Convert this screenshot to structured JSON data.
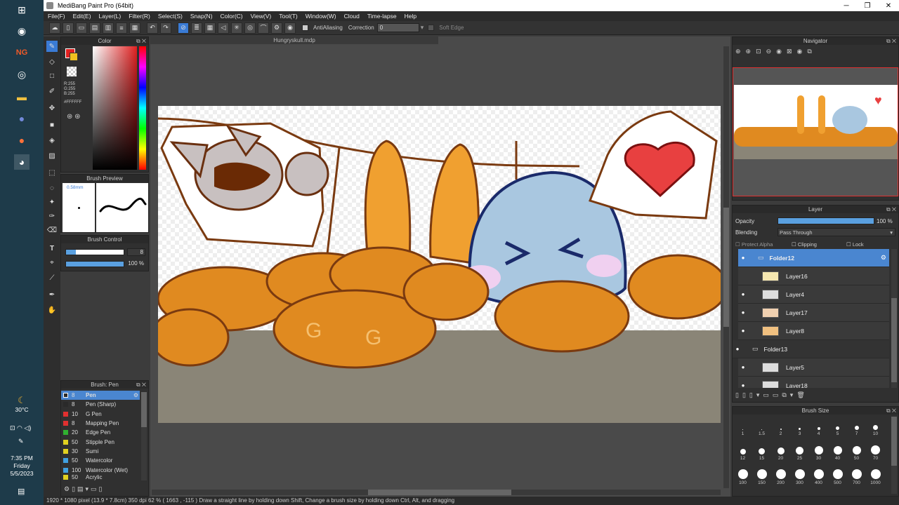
{
  "taskbar": {
    "weather_temp": "30°C",
    "time": "7:35 PM",
    "day": "Friday",
    "date": "5/5/2023"
  },
  "window": {
    "title": "MediBang Paint Pro (64bit)"
  },
  "menu": [
    "File(F)",
    "Edit(E)",
    "Layer(L)",
    "Filter(R)",
    "Select(S)",
    "Snap(N)",
    "Color(C)",
    "View(V)",
    "Tool(T)",
    "Window(W)",
    "Cloud",
    "Time-lapse",
    "Help"
  ],
  "toolbar": {
    "antialiasing_label": "AntiAliasing",
    "correction_label": "Correction",
    "correction_value": "0",
    "soft_edge_label": "Soft Edge"
  },
  "color_panel": {
    "title": "Color",
    "r": "R:255",
    "g": "G:255",
    "b": "B:255",
    "hex": "#FFFFFF",
    "accent": "#3a7bd5"
  },
  "brush_preview": {
    "title": "Brush Preview",
    "size": "0.58mm"
  },
  "brush_control": {
    "title": "Brush Control",
    "size_value": "8",
    "opacity_value": "100 %"
  },
  "brush_list": {
    "title": "Brush: Pen",
    "items": [
      {
        "num": "8",
        "name": "Pen",
        "color": "#2a2a2a",
        "selected": true
      },
      {
        "num": "8",
        "name": "Pen (Sharp)",
        "color": "#2a2a2a"
      },
      {
        "num": "10",
        "name": "G Pen",
        "color": "#e03030"
      },
      {
        "num": "8",
        "name": "Mapping Pen",
        "color": "#e03030"
      },
      {
        "num": "20",
        "name": "Edge Pen",
        "color": "#30b030"
      },
      {
        "num": "50",
        "name": "Stipple Pen",
        "color": "#e0d020"
      },
      {
        "num": "30",
        "name": "Sumi",
        "color": "#e0d020"
      },
      {
        "num": "50",
        "name": "Watercolor",
        "color": "#40a0e0"
      },
      {
        "num": "100",
        "name": "Watercolor (Wet)",
        "color": "#40a0e0"
      },
      {
        "num": "50",
        "name": "Acrylic",
        "color": "#e0d020"
      }
    ]
  },
  "document": {
    "tab_name": "Hungryskull.mdp"
  },
  "navigator": {
    "title": "Navigator"
  },
  "layer_panel": {
    "title": "Layer",
    "opacity_label": "Opacity",
    "opacity_value": "100 %",
    "blending_label": "Blending",
    "blending_value": "Pass Through",
    "protect_alpha": "Protect Alpha",
    "clipping": "Clipping",
    "lock": "Lock",
    "layers": [
      {
        "name": "Folder12",
        "folder": true,
        "selected": true,
        "visible": true
      },
      {
        "name": "Layer16",
        "folder": false,
        "visible": false
      },
      {
        "name": "Layer4",
        "folder": false,
        "visible": true
      },
      {
        "name": "Layer17",
        "folder": false,
        "visible": true
      },
      {
        "name": "Layer8",
        "folder": false,
        "visible": true
      },
      {
        "name": "Folder13",
        "folder": true,
        "visible": true
      },
      {
        "name": "Layer5",
        "folder": false,
        "visible": true
      },
      {
        "name": "Layer18",
        "folder": false,
        "visible": true
      }
    ]
  },
  "brush_size": {
    "title": "Brush Size",
    "sizes": [
      "1",
      "1.5",
      "2",
      "3",
      "4",
      "5",
      "7",
      "10",
      "12",
      "15",
      "20",
      "25",
      "30",
      "40",
      "50",
      "70",
      "100",
      "150",
      "200",
      "300",
      "400",
      "500",
      "700",
      "1000"
    ]
  },
  "status": {
    "text": "1920 * 1080 pixel  (13.9 * 7.8cm)  350 dpi  62 %  ( 1663 , -115 )  Draw a straight line by holding down Shift, Change a brush size by holding down Ctrl, Alt, and dragging"
  }
}
